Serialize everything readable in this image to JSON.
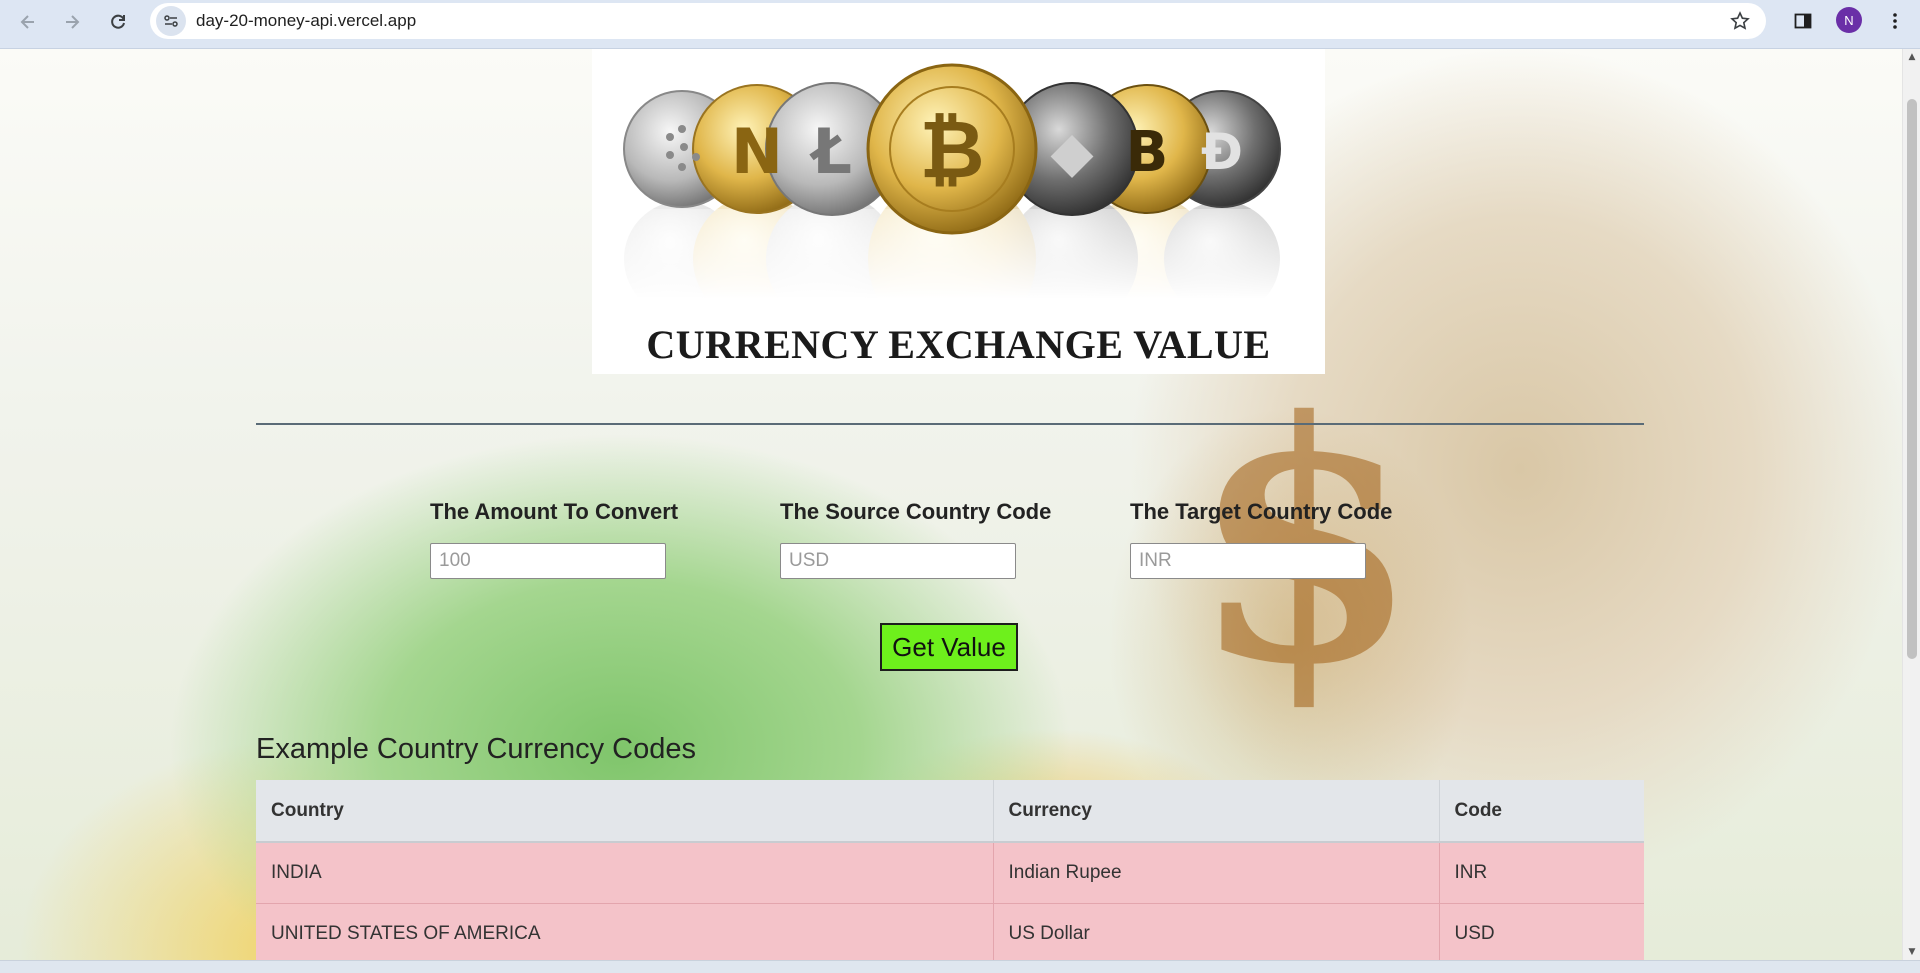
{
  "browser": {
    "url": "day-20-money-api.vercel.app",
    "profile_initial": "N",
    "accent": "#6a2fa7"
  },
  "header": {
    "title": "CURRENCY EXCHANGE VALUE",
    "banner_image": "cryptocurrency-coins"
  },
  "form": {
    "amount": {
      "label": "The Amount To Convert",
      "placeholder": "100"
    },
    "source": {
      "label": "The Source Country Code",
      "placeholder": "USD"
    },
    "target": {
      "label": "The Target Country Code",
      "placeholder": "INR"
    },
    "submit_label": "Get Value",
    "submit_color": "#6ef01c"
  },
  "table": {
    "title": "Example Country Currency Codes",
    "columns": [
      "Country",
      "Currency",
      "Code"
    ],
    "rows": [
      [
        "INDIA",
        "Indian Rupee",
        "INR"
      ],
      [
        "UNITED STATES OF AMERICA",
        "US Dollar",
        "USD"
      ]
    ],
    "row_color": "#f4c3c9"
  }
}
